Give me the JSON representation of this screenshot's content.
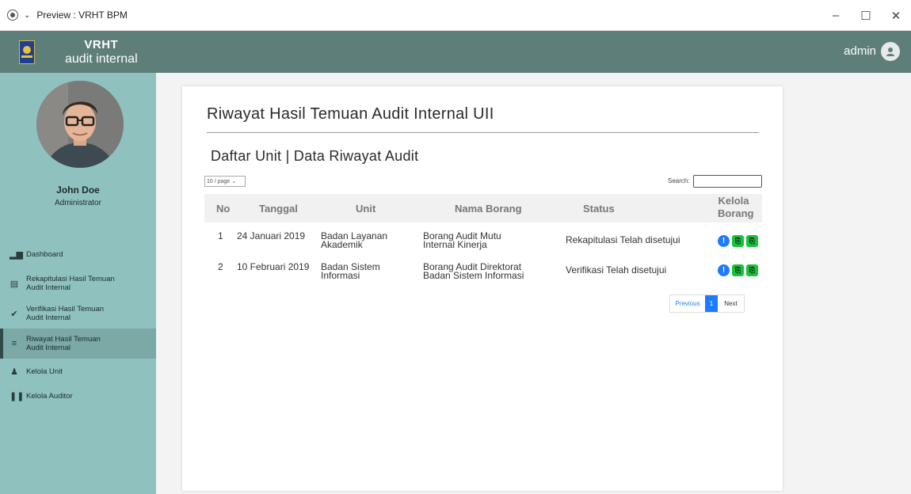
{
  "window": {
    "title": "Preview : VRHT BPM",
    "controls": [
      "–",
      "☐",
      "✕"
    ]
  },
  "brand": {
    "line1": "VRHT",
    "line2": "audit internal"
  },
  "user": {
    "name": "John Doe",
    "role": "Administrator"
  },
  "nav": [
    {
      "icon": "bar-chart-icon",
      "label": "Dashboard",
      "active": false
    },
    {
      "icon": "list-icon",
      "label": "Rekapitulasi Hasil Temuan Audit Internal",
      "active": false
    },
    {
      "icon": "check-circle-icon",
      "label": "Verifikasi Hasil Temuan Audit Internal",
      "active": false
    },
    {
      "icon": "menu-icon",
      "label": "Riwayat Hasil Temuan Audit Internal",
      "active": true
    },
    {
      "icon": "user-icon",
      "label": "Kelola Unit",
      "active": false
    },
    {
      "icon": "barcode-icon",
      "label": "Kelola Auditor",
      "active": false
    }
  ],
  "topbar": {
    "user": "admin"
  },
  "page": {
    "title": "Riwayat Hasil Temuan Audit Internal UII",
    "subtitle": "Daftar Unit | Data Riwayat Audit"
  },
  "table": {
    "page_size": "10 / page",
    "search_label": "Search:",
    "search_value": "",
    "headers": {
      "no": "No",
      "tanggal": "Tanggal",
      "unit": "Unit",
      "nama": "Nama Borang",
      "status": "Status",
      "kelola": "Kelola Borang"
    },
    "rows": [
      {
        "no": "1",
        "tanggal": "24 Januari 2019",
        "unit": "Badan Layanan Akademik",
        "nama": "Borang Audit Mutu Internal Kinerja",
        "status": "Rekapitulasi Telah disetujui"
      },
      {
        "no": "2",
        "tanggal": "10 Februari 2019",
        "unit": "Badan Sistem Informasi",
        "nama": "Borang Audit Direktorat Badan Sistem Informasi",
        "status": "Verifikasi Telah disetujui"
      }
    ]
  },
  "pagination": {
    "prev": "Previous",
    "current": "1",
    "next": "Next"
  },
  "colors": {
    "sidebar": "#8fc2bf",
    "header": "#5d7e79",
    "accent": "#1e7bff",
    "pdf": "#18c23c"
  }
}
